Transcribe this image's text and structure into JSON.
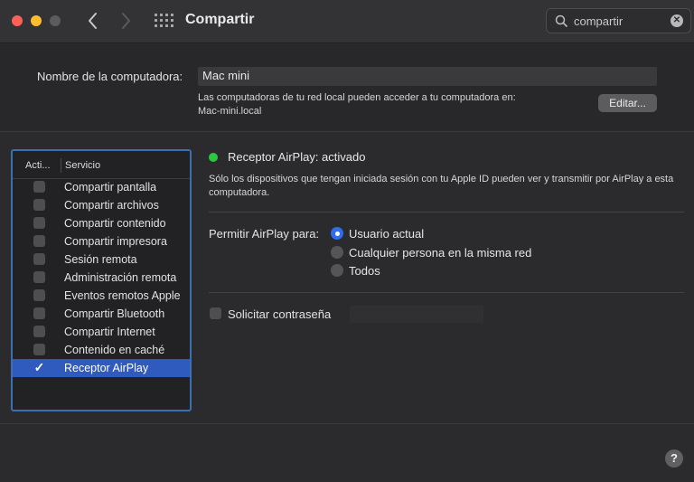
{
  "window": {
    "title": "Compartir"
  },
  "search": {
    "value": "compartir",
    "clear_icon": "clear-icon"
  },
  "computer": {
    "label": "Nombre de la computadora:",
    "name": "Mac mini",
    "desc_line1": "Las computadoras de tu red local pueden acceder a tu computadora en:",
    "desc_line2": "Mac-mini.local",
    "edit_label": "Editar..."
  },
  "services": {
    "col_on": "Acti...",
    "col_service": "Servicio",
    "items": [
      {
        "label": "Compartir pantalla",
        "checked": false
      },
      {
        "label": "Compartir archivos",
        "checked": false
      },
      {
        "label": "Compartir contenido",
        "checked": false
      },
      {
        "label": "Compartir impresora",
        "checked": false
      },
      {
        "label": "Sesión remota",
        "checked": false
      },
      {
        "label": "Administración remota",
        "checked": false
      },
      {
        "label": "Eventos remotos Apple",
        "checked": false
      },
      {
        "label": "Compartir Bluetooth",
        "checked": false
      },
      {
        "label": "Compartir Internet",
        "checked": false
      },
      {
        "label": "Contenido en caché",
        "checked": false
      },
      {
        "label": "Receptor AirPlay",
        "checked": true,
        "selected": true
      }
    ]
  },
  "detail": {
    "status": "Receptor AirPlay: activado",
    "status_color": "#2ac840",
    "description": "Sólo los dispositivos que tengan iniciada sesión con tu Apple ID pueden ver y transmitir por AirPlay a esta computadora.",
    "allow_label": "Permitir AirPlay para:",
    "options": [
      {
        "label": "Usuario actual",
        "selected": true
      },
      {
        "label": "Cualquier persona en la misma red",
        "selected": false
      },
      {
        "label": "Todos",
        "selected": false
      }
    ],
    "password_label": "Solicitar contraseña",
    "password_checked": false
  },
  "help": {
    "label": "?"
  },
  "colors": {
    "accent": "#2f6df0",
    "selection": "#2f5bbf",
    "focus_ring": "#3c6fb2"
  }
}
